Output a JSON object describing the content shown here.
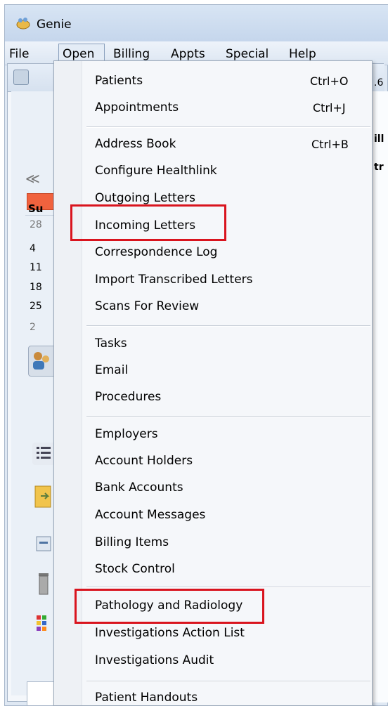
{
  "window": {
    "title": "Genie"
  },
  "menubar": {
    "items": [
      "File",
      "Open",
      "Billing",
      "Appts",
      "Special",
      "Help"
    ]
  },
  "background": {
    "tab_fragment": ".6",
    "right_fragment_1": "ill",
    "right_fragment_2": "tr",
    "nav_arrows": "≪",
    "calendar_header": "Su",
    "calendar_days": [
      "28",
      "4",
      "11",
      "18",
      "25",
      "2"
    ]
  },
  "dropdown": {
    "groups": [
      [
        {
          "label": "Patients",
          "shortcut": "Ctrl+O"
        },
        {
          "label": "Appointments",
          "shortcut": "Ctrl+J"
        }
      ],
      [
        {
          "label": "Address Book",
          "shortcut": "Ctrl+B"
        },
        {
          "label": "Configure Healthlink"
        },
        {
          "label": "Outgoing Letters"
        },
        {
          "label": "Incoming Letters"
        },
        {
          "label": "Correspondence Log"
        },
        {
          "label": "Import Transcribed Letters"
        },
        {
          "label": "Scans For Review"
        }
      ],
      [
        {
          "label": "Tasks"
        },
        {
          "label": "Email"
        },
        {
          "label": "Procedures"
        }
      ],
      [
        {
          "label": "Employers"
        },
        {
          "label": "Account Holders"
        },
        {
          "label": "Bank Accounts"
        },
        {
          "label": "Account Messages"
        },
        {
          "label": "Billing Items"
        },
        {
          "label": "Stock Control"
        }
      ],
      [
        {
          "label": "Pathology and Radiology"
        },
        {
          "label": "Investigations Action List"
        },
        {
          "label": "Investigations Audit"
        }
      ],
      [
        {
          "label": "Patient Handouts"
        }
      ]
    ],
    "highlighted": [
      "Incoming Letters",
      "Pathology and Radiology"
    ],
    "highlight_color": "#d9141e"
  }
}
